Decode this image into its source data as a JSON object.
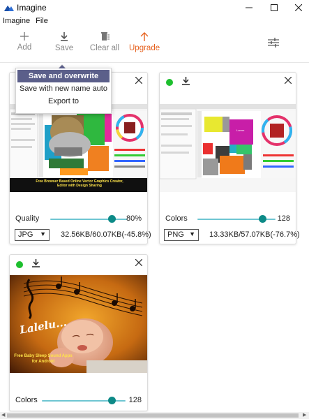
{
  "window": {
    "title": "Imagine"
  },
  "menu": {
    "items": [
      "Imagine",
      "File"
    ]
  },
  "toolbar": {
    "add_label": "Add",
    "save_label": "Save",
    "clear_label": "Clear all",
    "upgrade_label": "Upgrade",
    "accent_color": "#e6611e"
  },
  "save_menu": {
    "items": [
      "Save and overwrite",
      "Save with new name auto",
      "Export to"
    ]
  },
  "cards": [
    {
      "slider_label": "Quality",
      "slider_value": "80%",
      "slider_level": 0.8,
      "format": "JPG",
      "size_info": "32.56KB/60.07KB(-45.8%)",
      "caption": "Free Browser Based Online Vector Graphics Creator, Editor with Design Sharing"
    },
    {
      "slider_label": "Colors",
      "slider_value": "128",
      "slider_level": 0.83,
      "format": "PNG",
      "size_info": "13.33KB/57.07KB(-76.7%)",
      "canvas_text": "Lorem"
    },
    {
      "slider_label": "Colors",
      "slider_value": "128",
      "slider_level": 0.83,
      "photo_title": "Lalelu...",
      "photo_caption": "Free Baby Sleep Sound Apps for Android"
    }
  ],
  "status_color": "#1dbf2e"
}
